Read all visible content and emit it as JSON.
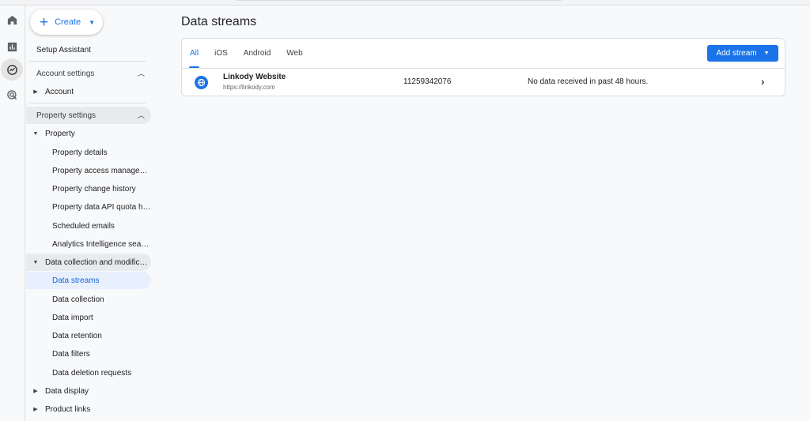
{
  "rail": {
    "icons": [
      "home-icon",
      "reports-icon",
      "explore-icon",
      "advertising-icon"
    ]
  },
  "sidebar": {
    "create_label": "Create",
    "setup_assistant": "Setup Assistant",
    "account_settings": "Account settings",
    "account": "Account",
    "property_settings": "Property settings",
    "property": "Property",
    "property_items": [
      "Property details",
      "Property access managem…",
      "Property change history",
      "Property data API quota hi…",
      "Scheduled emails",
      "Analytics Intelligence sear…"
    ],
    "data_collection_group": "Data collection and modifica…",
    "data_items": [
      "Data streams",
      "Data collection",
      "Data import",
      "Data retention",
      "Data filters",
      "Data deletion requests"
    ],
    "data_display": "Data display",
    "product_links": "Product links"
  },
  "main": {
    "title": "Data streams",
    "tabs": [
      "All",
      "iOS",
      "Android",
      "Web"
    ],
    "active_tab": "All",
    "add_stream_label": "Add stream",
    "streams": [
      {
        "name": "Linkody Website",
        "url": "https://linkody.com",
        "id": "11259342076",
        "status": "No data received in past 48 hours."
      }
    ]
  },
  "colors": {
    "accent": "#1a73e8",
    "active_nav_bg": "#e8f0fe",
    "background": "#f8f9fa"
  }
}
